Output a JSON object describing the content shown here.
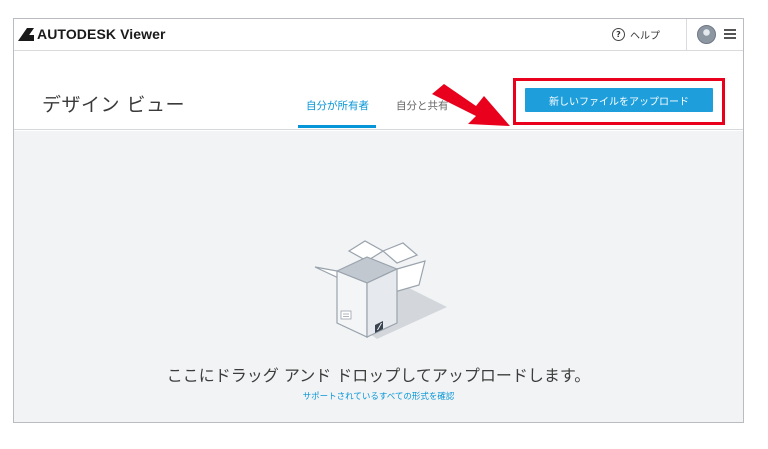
{
  "app": {
    "brand": "AUTODESK Viewer"
  },
  "topbar": {
    "help_label": "ヘルプ",
    "help_icon": "question-circle-icon",
    "menu_icon": "hamburger-icon"
  },
  "header": {
    "title": "デザイン ビュー",
    "tabs": [
      {
        "label": "自分が所有者",
        "active": true
      },
      {
        "label": "自分と共有",
        "active": false
      }
    ],
    "upload_button": "新しいファイルをアップロード"
  },
  "dropzone": {
    "message": "ここにドラッグ アンド ドロップしてアップロードします。",
    "formats_link": "サポートされているすべての形式を確認",
    "illustration_icon": "open-box-icon"
  },
  "colors": {
    "accent": "#0696d7",
    "button": "#1e9fdc",
    "annotation": "#e8001c",
    "dropzone_bg": "#f2f3f5"
  }
}
